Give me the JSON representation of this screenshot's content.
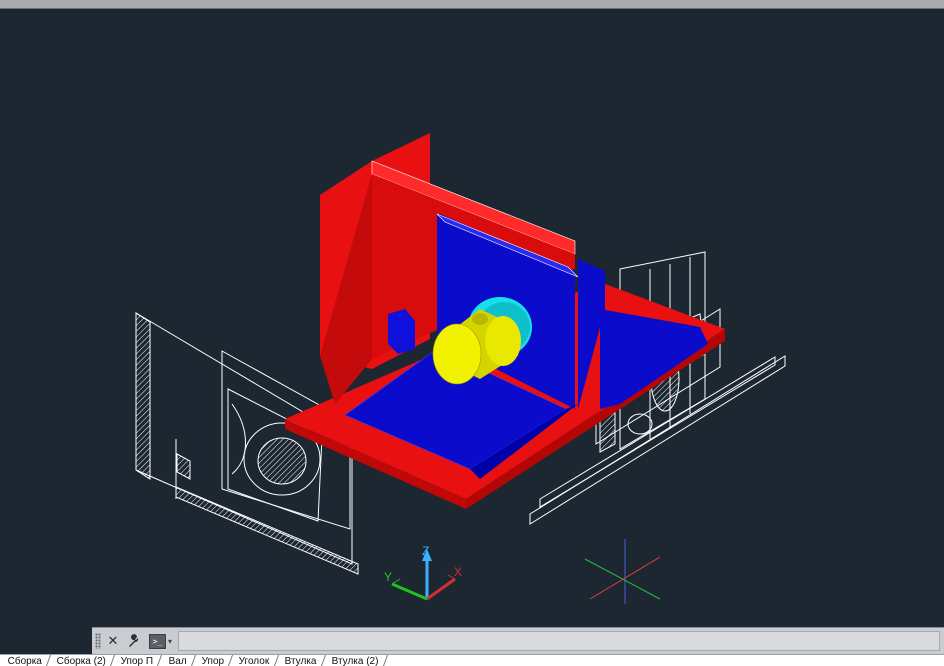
{
  "topbar": {},
  "viewport": {
    "ucs_icon": {
      "x_label": "X",
      "y_label": "Y",
      "z_label": "Z"
    },
    "colors": {
      "background": "#1c2731",
      "red_part": "#e81010",
      "blue_part": "#0b0bcc",
      "yellow_part": "#e8e800",
      "cyan_part": "#16e0ea",
      "wireframe": "#ffffff"
    }
  },
  "command_line": {
    "close_icon": "✕",
    "settings_icon": "wrench-icon",
    "prompt_icon": ">_",
    "input_value": ""
  },
  "layout_tabs": [
    "Сборка",
    "Сборка (2)",
    "Упор П",
    "Вал",
    "Упор",
    "Уголок",
    "Втулка",
    "Втулка (2)"
  ]
}
